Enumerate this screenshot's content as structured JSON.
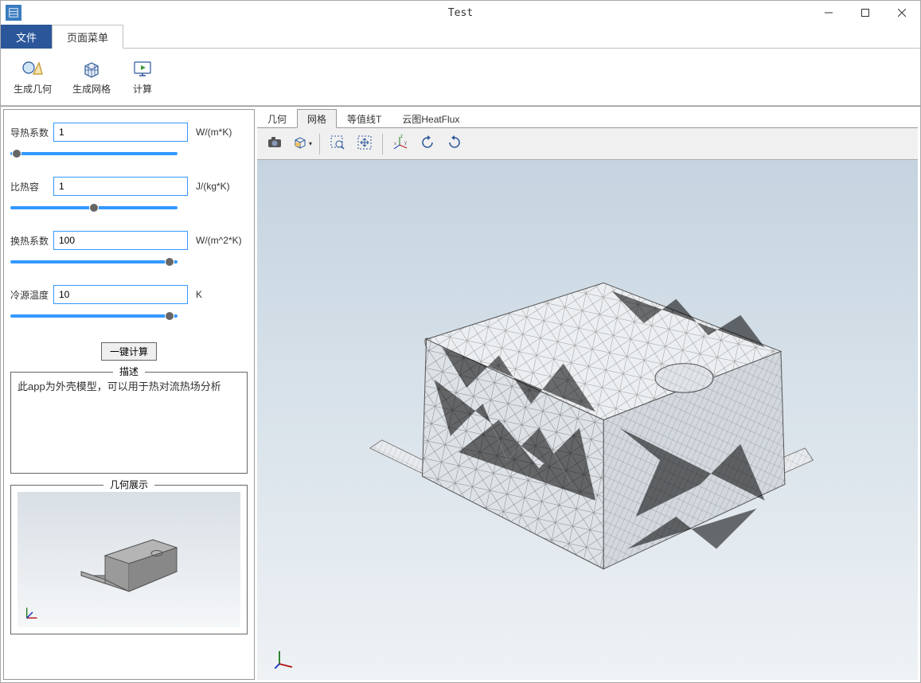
{
  "window": {
    "title": "Test"
  },
  "tabs": {
    "file": "文件",
    "page_menu": "页面菜单"
  },
  "ribbon": {
    "gen_geom": "生成几何",
    "gen_mesh": "生成网格",
    "compute": "计算"
  },
  "params": {
    "thermal_cond": {
      "label": "导热系数",
      "value": "1",
      "unit": "W/(m*K)"
    },
    "spec_heat": {
      "label": "比热容",
      "value": "1",
      "unit": "J/(kg*K)"
    },
    "heat_transfer": {
      "label": "换热系数",
      "value": "100",
      "unit": "W/(m^2*K)"
    },
    "cold_temp": {
      "label": "冷源温度",
      "value": "10",
      "unit": "K"
    }
  },
  "compute_btn": "一键计算",
  "desc": {
    "legend": "描述",
    "text": "此app为外壳模型，可以用于热对流热场分析"
  },
  "geom_preview": {
    "legend": "几何展示"
  },
  "view_tabs": {
    "geometry": "几何",
    "mesh": "网格",
    "contour": "等值线T",
    "cloud": "云图HeatFlux"
  }
}
